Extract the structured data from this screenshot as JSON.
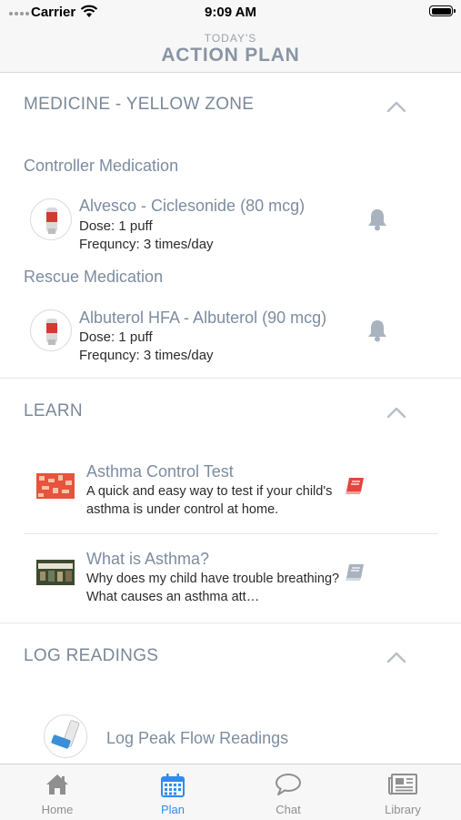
{
  "status_bar": {
    "carrier": "Carrier",
    "time": "9:09 AM"
  },
  "header": {
    "subtitle": "TODAY'S",
    "title": "ACTION PLAN"
  },
  "medicine": {
    "title": "MEDICINE - YELLOW ZONE",
    "controller": {
      "label": "Controller Medication",
      "name": "Alvesco - Ciclesonide (80 mcg)",
      "dose": "Dose: 1 puff",
      "frequency": "Frequncy: 3 times/day"
    },
    "rescue": {
      "label": "Rescue Medication",
      "name": "Albuterol HFA - Albuterol (90 mcg)",
      "dose": "Dose: 1 puff",
      "frequency": "Frequncy: 3 times/day"
    }
  },
  "learn": {
    "title": "LEARN",
    "items": [
      {
        "title": "Asthma Control Test",
        "description": "A quick and easy way to test if your child's asthma is under control at home.",
        "book_color": "#e2463f"
      },
      {
        "title": "What is Asthma?",
        "description": "Why does my child have trouble breathing? What causes an asthma att…",
        "book_color": "#a9b3c0"
      }
    ]
  },
  "log_readings": {
    "title": "LOG READINGS",
    "item": "Log Peak Flow Readings"
  },
  "tabs": [
    {
      "label": "Home",
      "icon": "home-icon"
    },
    {
      "label": "Plan",
      "icon": "calendar-icon"
    },
    {
      "label": "Chat",
      "icon": "chat-icon"
    },
    {
      "label": "Library",
      "icon": "newspaper-icon"
    }
  ],
  "colors": {
    "accent": "#2f8df2",
    "section_text": "#7b8899",
    "tab_inactive": "#8f8f8f",
    "alert_red": "#e2463f"
  }
}
